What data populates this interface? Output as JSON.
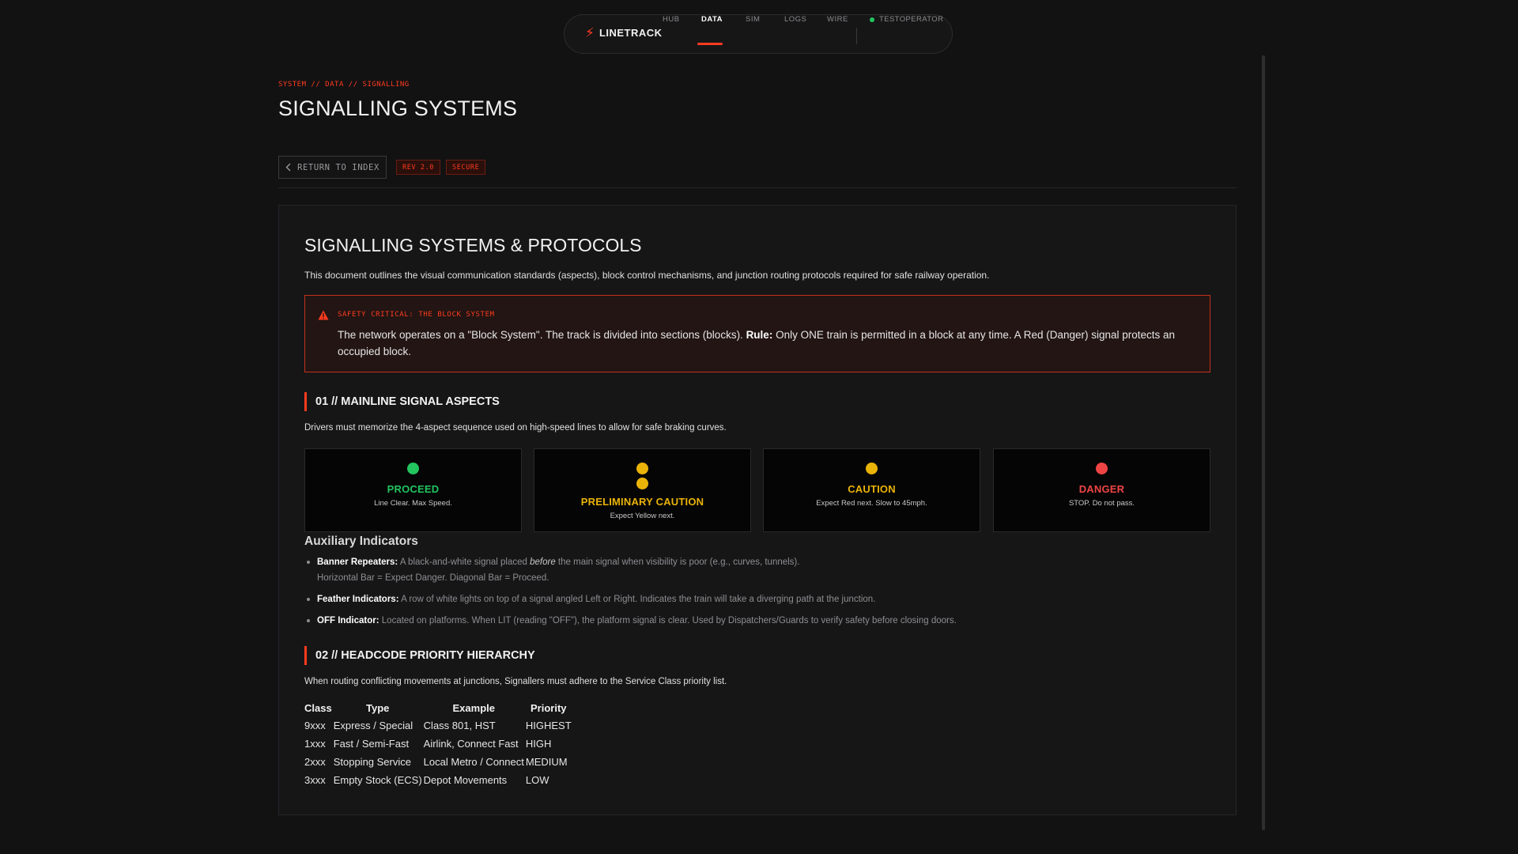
{
  "nav": {
    "brand": "LINETRACK",
    "brand_icon": "lightning-bolt-icon",
    "items": [
      "HUB",
      "DATA",
      "SIM",
      "LOGS",
      "WIRE"
    ],
    "active": "DATA",
    "user": "TESTOPERATOR",
    "user_status_color": "#22c55e",
    "accent": "#ff3b1f"
  },
  "header": {
    "breadcrumb": "SYSTEM // DATA // SIGNALLING",
    "title": "SIGNALLING SYSTEMS",
    "back_button": "RETURN TO INDEX",
    "badges": [
      "REV 2.0",
      "SECURE"
    ]
  },
  "doc": {
    "title": "SIGNALLING SYSTEMS & PROTOCOLS",
    "intro": "This document outlines the visual communication standards (aspects), block control mechanisms, and junction routing protocols required for safe railway operation.",
    "alert": {
      "label": "SAFETY CRITICAL: THE BLOCK SYSTEM",
      "text_before": "The network operates on a \"Block System\". The track is divided into sections (blocks). ",
      "rule_label": "Rule:",
      "text_after": " Only ONE train is permitted in a block at any time. A Red (Danger) signal protects an occupied block."
    },
    "section1": {
      "title": "01 // MAINLINE SIGNAL ASPECTS",
      "description": "Drivers must memorize the 4-aspect sequence used on high-speed lines to allow for safe braking curves.",
      "aspects": [
        {
          "name": "PROCEED",
          "description": "Line Clear. Max Speed.",
          "color": "#22c55e",
          "lamps": 1
        },
        {
          "name": "PRELIMINARY CAUTION",
          "description": "Expect Yellow next.",
          "color": "#eab308",
          "lamps": 2
        },
        {
          "name": "CAUTION",
          "description": "Expect Red next. Slow to 45mph.",
          "color": "#eab308",
          "lamps": 1
        },
        {
          "name": "DANGER",
          "description": "STOP. Do not pass.",
          "color": "#ef4444",
          "lamps": 1
        }
      ]
    },
    "auxiliary": {
      "title": "Auxiliary Indicators",
      "items": [
        {
          "label": "Banner Repeaters:",
          "text_before": " A black-and-white signal placed ",
          "emphasis": "before",
          "text_after": " the main signal when visibility is poor (e.g., curves, tunnels).",
          "second_line": "Horizontal Bar = Expect Danger. Diagonal Bar = Proceed."
        },
        {
          "label": "Feather Indicators:",
          "text": " A row of white lights on top of a signal angled Left or Right. Indicates the train will take a diverging path at the junction."
        },
        {
          "label": "OFF Indicator:",
          "text": " Located on platforms. When LIT (reading \"OFF\"), the platform signal is clear. Used by Dispatchers/Guards to verify safety before closing doors."
        }
      ]
    },
    "section2": {
      "title": "02 // HEADCODE PRIORITY HIERARCHY",
      "description": "When routing conflicting movements at junctions, Signallers must adhere to the Service Class priority list.",
      "columns": [
        "Class",
        "Type",
        "Example",
        "Priority"
      ],
      "rows": [
        [
          "9xxx",
          "Express / Special",
          "Class 801, HST",
          "HIGHEST"
        ],
        [
          "1xxx",
          "Fast / Semi-Fast",
          "Airlink, Connect Fast",
          "HIGH"
        ],
        [
          "2xxx",
          "Stopping Service",
          "Local Metro / Connect",
          "MEDIUM"
        ],
        [
          "3xxx",
          "Empty Stock (ECS)",
          "Depot Movements",
          "LOW"
        ]
      ]
    }
  }
}
